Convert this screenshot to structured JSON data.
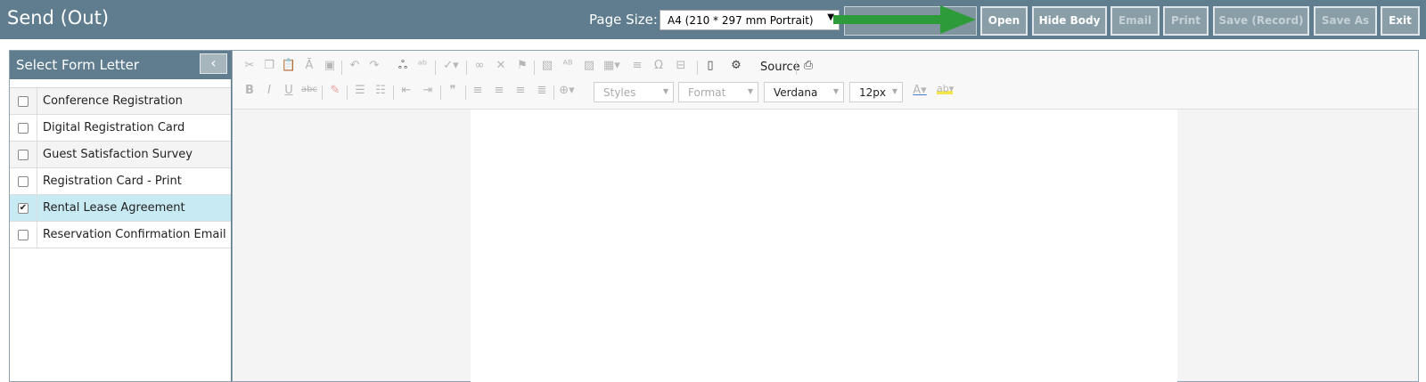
{
  "header": {
    "title": "Send (Out)",
    "page_size_label": "Page Size:",
    "page_size_value": "A4 (210 * 297 mm Portrait)",
    "buttons": [
      {
        "label": "Open",
        "enabled": true
      },
      {
        "label": "Hide Body",
        "enabled": true
      },
      {
        "label": "Email",
        "enabled": false
      },
      {
        "label": "Print",
        "enabled": false
      },
      {
        "label": "Save (Record)",
        "enabled": false
      },
      {
        "label": "Save As",
        "enabled": false
      },
      {
        "label": "Exit",
        "enabled": true
      }
    ]
  },
  "left_panel": {
    "title": "Select Form Letter",
    "collapse_icon": "chevron-left-icon",
    "items": [
      {
        "label": "Conference Registration",
        "checked": false
      },
      {
        "label": "Digital Registration Card",
        "checked": false
      },
      {
        "label": "Guest Satisfaction Survey",
        "checked": false
      },
      {
        "label": "Registration Card - Print",
        "checked": false
      },
      {
        "label": "Rental Lease Agreement",
        "checked": true
      },
      {
        "label": "Reservation Confirmation Email",
        "checked": false
      }
    ]
  },
  "editor": {
    "source_label": "Source",
    "styles_combo": "Styles",
    "format_combo": "Format",
    "font_combo": "Verdana",
    "size_combo": "12px",
    "toolbar_row1_icons": [
      "cut-icon",
      "copy-icon",
      "paste-icon",
      "paste-text-icon",
      "paste-word-icon",
      "undo-icon",
      "redo-icon",
      "find-icon",
      "replace-icon",
      "spellcheck-icon",
      "link-icon",
      "unlink-icon",
      "anchor-icon",
      "image-icon",
      "superscript-image-icon",
      "image2-icon",
      "table-icon",
      "horizontal-rule-icon",
      "special-char-icon",
      "page-break-icon",
      "preview-icon",
      "source-icon",
      "print-icon"
    ],
    "toolbar_row2_icons": [
      "bold-icon",
      "italic-icon",
      "underline-icon",
      "strikethrough-icon",
      "remove-format-icon",
      "numbered-list-icon",
      "bulleted-list-icon",
      "outdent-icon",
      "indent-icon",
      "blockquote-icon",
      "align-left-icon",
      "align-center-icon",
      "align-right-icon",
      "justify-icon",
      "language-icon",
      "text-color-icon",
      "background-color-icon"
    ]
  },
  "colors": {
    "header_bg": "#5f7d8e",
    "button_bg": "#8a9ea8",
    "selected_row": "#c8ebf3",
    "arrow": "#2e9b3a"
  }
}
